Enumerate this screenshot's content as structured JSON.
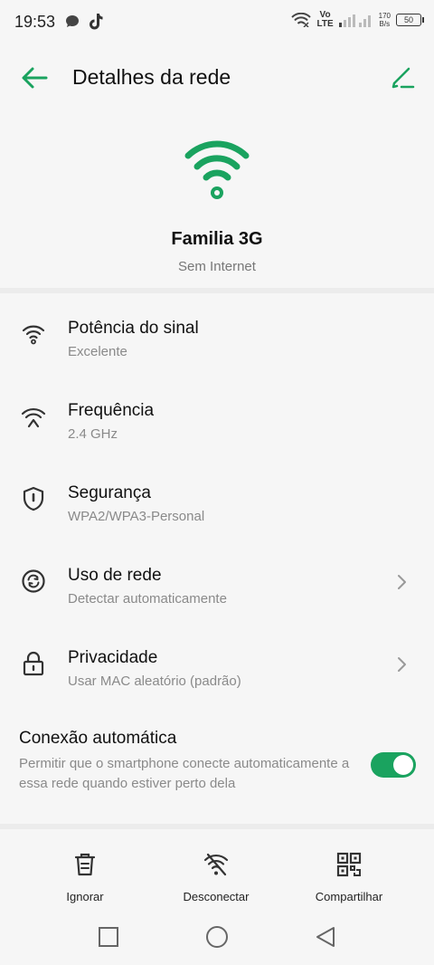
{
  "status_bar": {
    "time": "19:53",
    "left_icons": [
      "chat-bubble-icon",
      "tiktok-icon"
    ],
    "volte_top": "Vo",
    "volte_bottom": "LTE",
    "speed_value": "170",
    "speed_unit": "B/s",
    "battery": "50"
  },
  "app_bar": {
    "title": "Detalhes da rede",
    "back_icon": "arrow-left-icon",
    "edit_icon": "pencil-icon"
  },
  "network": {
    "name": "Familia 3G",
    "status": "Sem Internet"
  },
  "details": [
    {
      "title": "Potência do sinal",
      "subtitle": "Excelente",
      "icon": "wifi-signal-icon",
      "chevron": false
    },
    {
      "title": "Frequência",
      "subtitle": "2.4 GHz",
      "icon": "frequency-icon",
      "chevron": false
    },
    {
      "title": "Segurança",
      "subtitle": "WPA2/WPA3-Personal",
      "icon": "shield-icon",
      "chevron": false
    },
    {
      "title": "Uso de rede",
      "subtitle": "Detectar automaticamente",
      "icon": "data-usage-icon",
      "chevron": true
    },
    {
      "title": "Privacidade",
      "subtitle": "Usar MAC aleatório (padrão)",
      "icon": "lock-icon",
      "chevron": true
    }
  ],
  "auto_connect": {
    "title": "Conexão automática",
    "description": "Permitir que o smartphone conecte automaticamente a essa rede quando estiver perto dela",
    "enabled": true
  },
  "actions": {
    "forget": "Ignorar",
    "disconnect": "Desconectar",
    "share": "Compartilhar"
  },
  "colors": {
    "accent": "#1aa35f",
    "text_primary": "#111111",
    "text_secondary": "#8a8a8a",
    "background": "#f6f6f6"
  }
}
